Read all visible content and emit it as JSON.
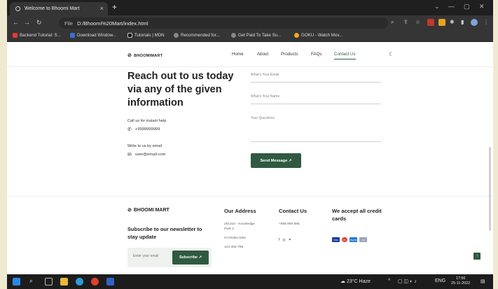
{
  "browser": {
    "tab_title": "Welcome to Bhoomi Mart",
    "tab_close": "×",
    "new_tab": "+",
    "address_label": "File",
    "address_url": "D:/Bhoomi%20Mart/index.html",
    "bookmarks": [
      "Backend Tutorial: S...",
      "Download Window...",
      "Tutorials | MDN",
      "Recommended for...",
      "Get Paid To Take Su...",
      "GOKU - Watch Mov..."
    ],
    "icons": {
      "back": "back-arrow-icon",
      "forward": "forward-arrow-icon",
      "reload": "reload-icon"
    }
  },
  "site": {
    "logo": "BHOOMIMART",
    "nav": [
      "Home",
      "About",
      "Products",
      "FAQs",
      "Contact Us"
    ],
    "active_nav": "Contact Us",
    "headline": "Reach out to us today via any of the given information",
    "call_label": "Call us for instant help",
    "phone": "+9999999999",
    "email_label": "Write to us by email",
    "email": "user@email.com",
    "form": {
      "email_placeholder": "What's Your Email",
      "name_placeholder": "What's Your Name",
      "questions_placeholder": "Your Questions",
      "send_label": "Send Message ↗"
    },
    "footer": {
      "logo": "BHOOMI MART",
      "subscribe_heading": "Subscribe to our newsletter to stay update",
      "subscribe_placeholder": "Enter your email",
      "subscribe_button": "Subscribe ↗",
      "address_heading": "Our Address",
      "address_lines": [
        "201310 - Knowledge",
        "Park 2",
        "Gr.Noida,India",
        "123-456-789"
      ],
      "contact_heading": "Contact Us",
      "contact_phone": "+888 999 888",
      "cards_heading": "We accept all credit cards",
      "card_names": [
        "VISA",
        "MC",
        "PayPal",
        "citi"
      ],
      "card_colors": [
        "#1a3f9a",
        "#e23a2a",
        "#2a7bd8",
        "#9aa7b8"
      ],
      "back_to_top": "↑"
    }
  },
  "taskbar": {
    "weather": "23°C Haze",
    "language": "ENG",
    "time": "17:56",
    "date": "25-11-2022"
  },
  "colors": {
    "accent": "#2f5a41"
  }
}
